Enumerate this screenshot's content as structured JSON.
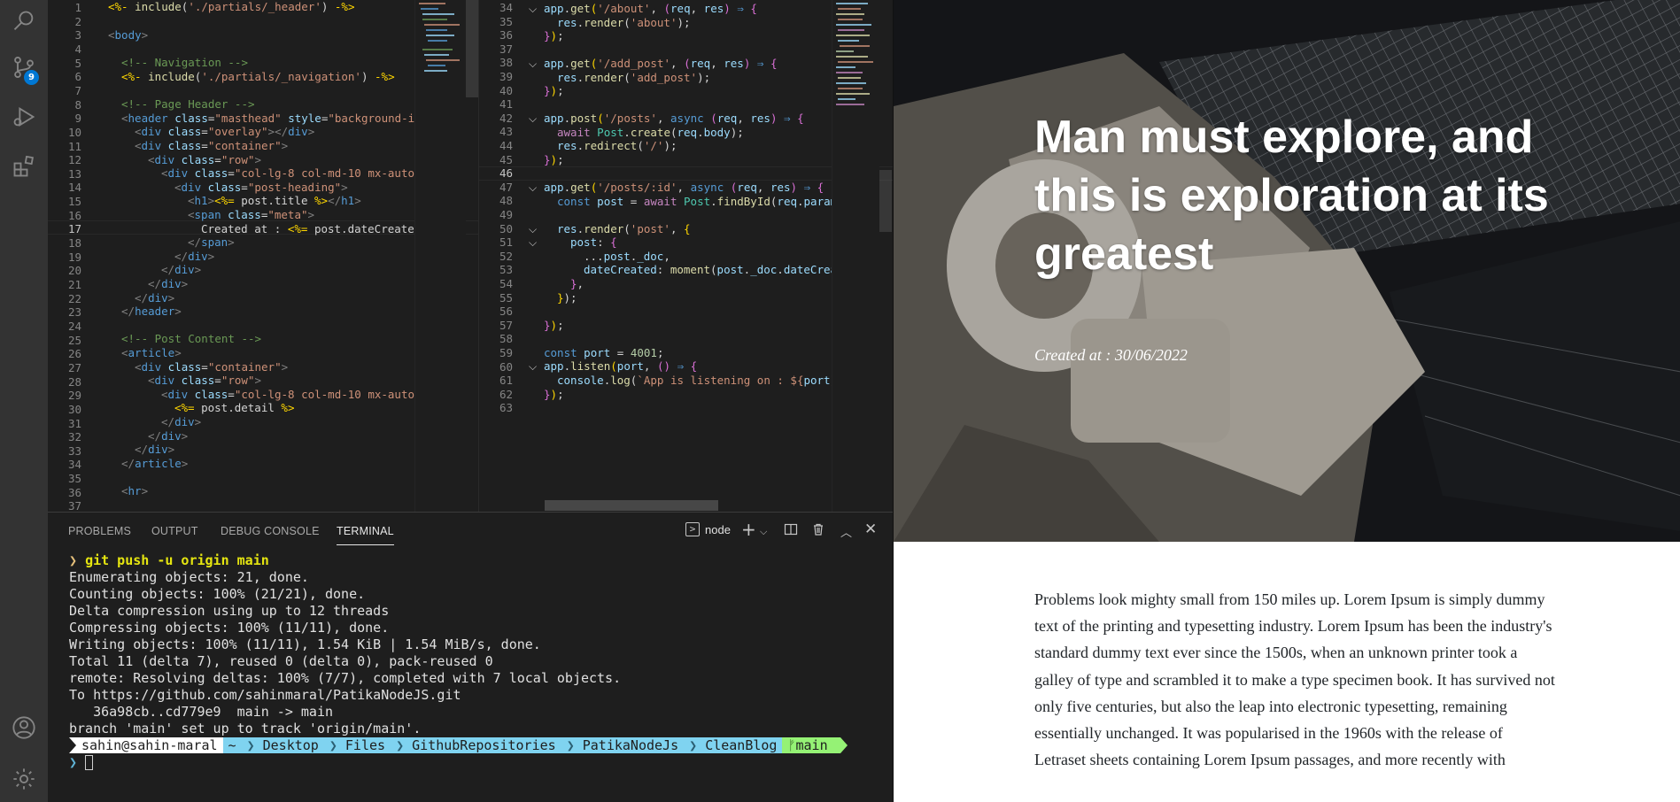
{
  "activity_bar": {
    "source_control_badge": "9"
  },
  "editor_left": {
    "line_numbers": [
      "1",
      "2",
      "3",
      "4",
      "5",
      "6",
      "7",
      "8",
      "9",
      "10",
      "11",
      "12",
      "13",
      "14",
      "15",
      "16",
      "17",
      "18",
      "19",
      "20",
      "21",
      "22",
      "23",
      "24",
      "25",
      "26",
      "27",
      "28",
      "29",
      "30",
      "31",
      "32",
      "33",
      "34",
      "35",
      "36",
      "37"
    ],
    "current_line": "17"
  },
  "editor_right": {
    "line_numbers": [
      "34",
      "35",
      "36",
      "37",
      "38",
      "39",
      "40",
      "41",
      "42",
      "43",
      "44",
      "45",
      "46",
      "47",
      "48",
      "49",
      "50",
      "51",
      "52",
      "53",
      "54",
      "55",
      "56",
      "57",
      "58",
      "59",
      "60",
      "61",
      "62",
      "63"
    ],
    "current_line": "46"
  },
  "panel": {
    "tabs": [
      "PROBLEMS",
      "OUTPUT",
      "DEBUG CONSOLE",
      "TERMINAL"
    ],
    "active_tab": "TERMINAL",
    "shell_label": "node",
    "terminal_lines": [
      "Enumerating objects: 21, done.",
      "Counting objects: 100% (21/21), done.",
      "Delta compression using up to 12 threads",
      "Compressing objects: 100% (11/11), done.",
      "Writing objects: 100% (11/11), 1.54 KiB | 1.54 MiB/s, done.",
      "Total 11 (delta 7), reused 0 (delta 0), pack-reused 0",
      "remote: Resolving deltas: 100% (7/7), completed with 7 local objects.",
      "To https://github.com/sahinmaral/PatikaNodeJS.git",
      "   36a98cb..cd779e9  main -> main",
      "branch 'main' set up to track 'origin/main'."
    ],
    "command_prompt": "❯",
    "command": "git push -u origin main",
    "prompt_segments": {
      "user": "sahin@sahin-maral",
      "home": "~",
      "path": [
        "Desktop",
        "Files",
        "GithubRepositories",
        "PatikaNodeJs",
        "CleanBlog"
      ],
      "branch": "main"
    }
  },
  "preview": {
    "title": "Man must explore, and this is exploration at its greatest",
    "meta": "Created at : 30/06/2022",
    "body": "Problems look mighty small from 150 miles up. Lorem Ipsum is simply dummy text of the printing and typesetting industry. Lorem Ipsum has been the industry's standard dummy text ever since the 1500s, when an unknown printer took a galley of type and scrambled it to make a type specimen book. It has survived not only five centuries, but also the leap into electronic typesetting, remaining essentially unchanged. It was popularised in the 1960s with the release of Letraset sheets containing Lorem Ipsum passages, and more recently with"
  },
  "colors": {
    "activity_bar": "#333333",
    "editor_bg": "#1e1e1e",
    "prompt_user_bg": "#ffffff",
    "prompt_path_bg": "#7fd3f0",
    "prompt_branch_bg": "#95f275",
    "accent_badge": "#0078d4"
  }
}
